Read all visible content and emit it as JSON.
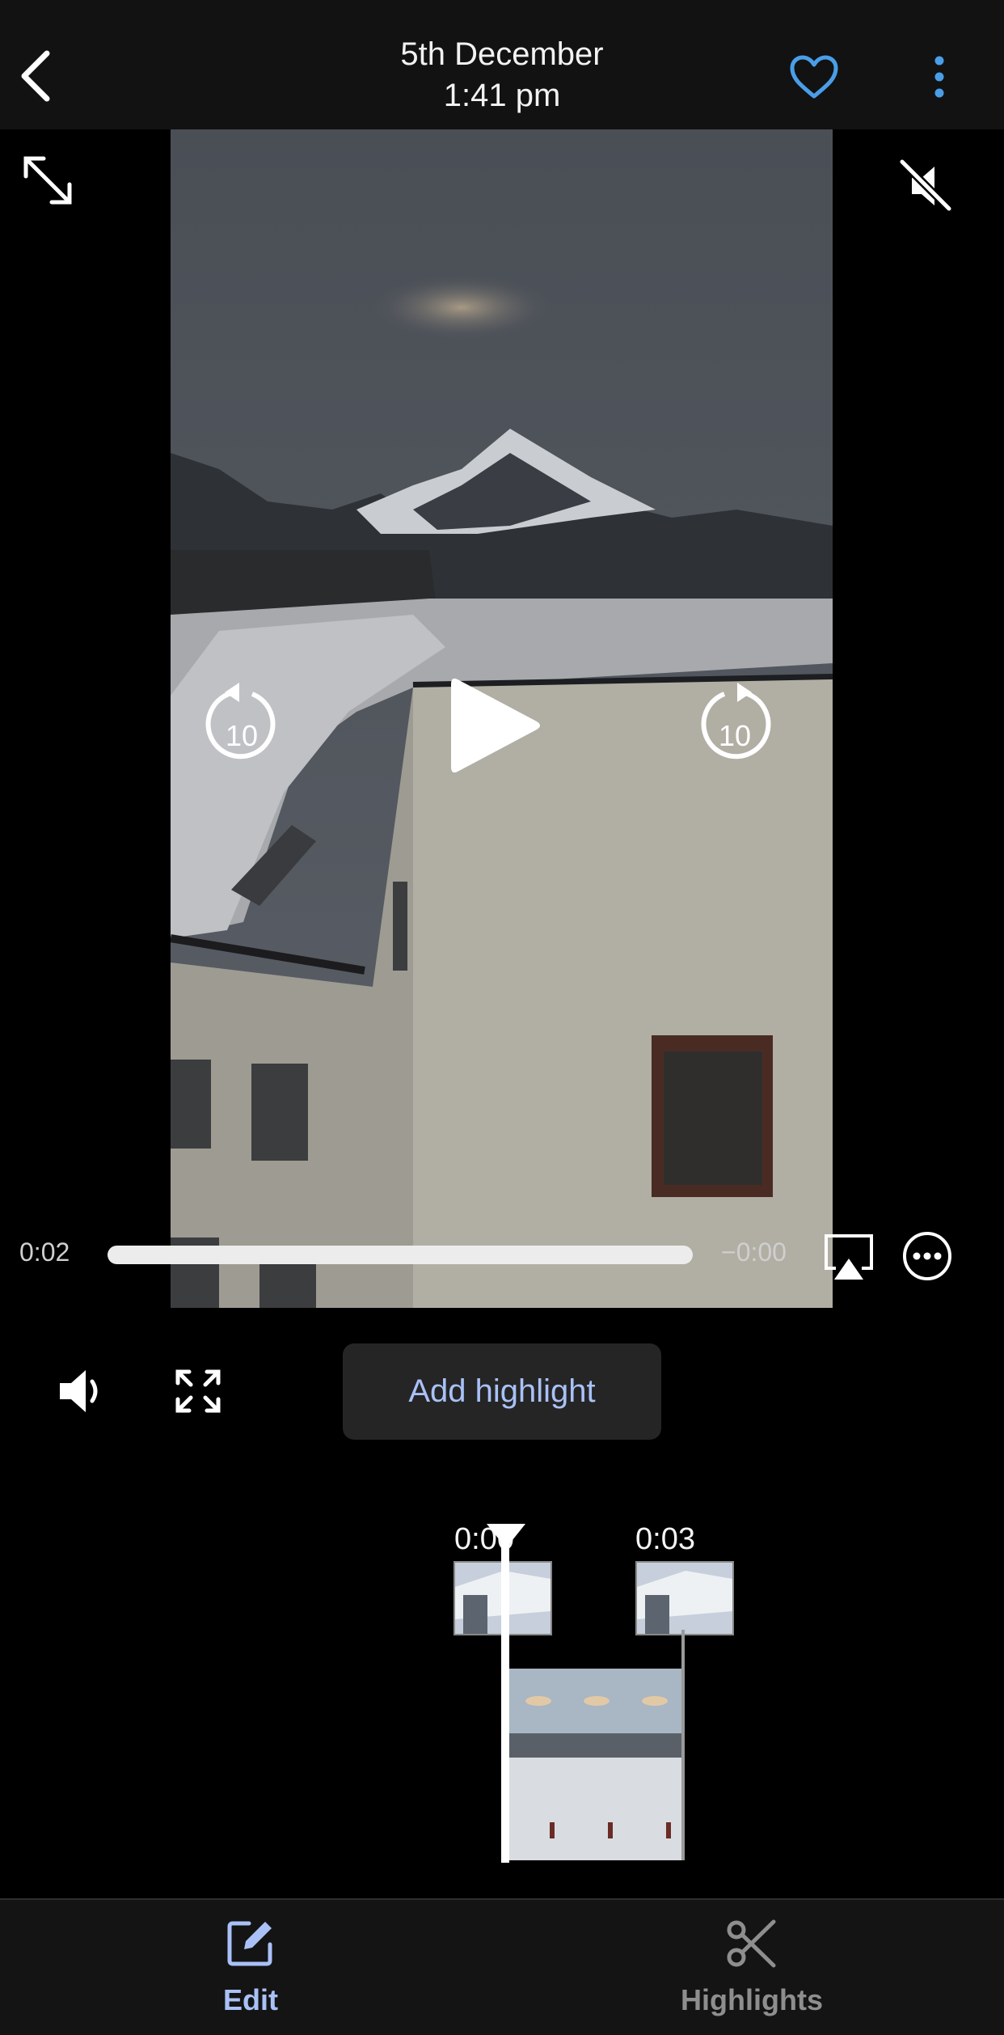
{
  "header": {
    "date": "5th December",
    "time": "1:41 pm"
  },
  "player": {
    "elapsed": "0:02",
    "remaining": "−0:00",
    "rewind_label": "10",
    "forward_label": "10",
    "progress": 1.0,
    "muted": true
  },
  "controls": {
    "add_highlight_label": "Add highlight"
  },
  "highlights_editor": {
    "start_time": "0:00",
    "end_time": "0:03"
  },
  "bottom_nav": {
    "items": [
      {
        "label": "Edit",
        "icon": "edit-icon",
        "active": true
      },
      {
        "label": "Highlights",
        "icon": "scissors-icon",
        "active": false
      }
    ]
  },
  "colors": {
    "accent_blue": "#4a9ee8",
    "active_tab": "#a9c1f7",
    "inactive_tab": "#8e8e8e"
  }
}
